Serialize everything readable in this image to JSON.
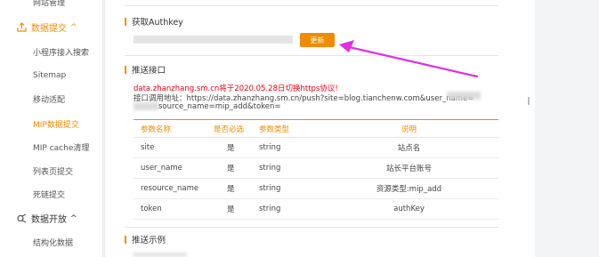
{
  "sidebar": {
    "top_item": "网站管理",
    "group_submit": "数据提交",
    "submit_items": [
      "小程序接入搜索",
      "Sitemap",
      "移动适配",
      "MIP数据提交",
      "MIP cache清理",
      "列表页提交",
      "死链提交"
    ],
    "group_open": "数据开放",
    "open_items": [
      "结构化数据"
    ],
    "active_item": "MIP数据提交",
    "accent_color": "#f08c00"
  },
  "authkey": {
    "title": "获取Authkey",
    "refresh_button": "更新"
  },
  "push": {
    "title": "推送接口",
    "notice": "data.zhanzhang.sm.cn将于2020.05.28日切换https协议!",
    "api_line1": "接口调用地址：https://data.zhanzhang.sm.cn/push?site=blog.tianchenw.com&user_name=",
    "api_line2": "source_name=mip_add&token="
  },
  "table": {
    "headers": [
      "参数名称",
      "是否必选",
      "参数类型",
      "说明"
    ],
    "rows": [
      [
        "site",
        "是",
        "string",
        "站点名"
      ],
      [
        "user_name",
        "是",
        "string",
        "站长平台账号"
      ],
      [
        "resource_name",
        "是",
        "string",
        "资源类型:mip_add"
      ],
      [
        "token",
        "是",
        "string",
        "authKey"
      ]
    ]
  },
  "example": {
    "title": "推送示例"
  },
  "icons": {
    "submit_group": "upload-icon",
    "open_group": "data-open-icon",
    "annotation": "magenta-arrow"
  }
}
